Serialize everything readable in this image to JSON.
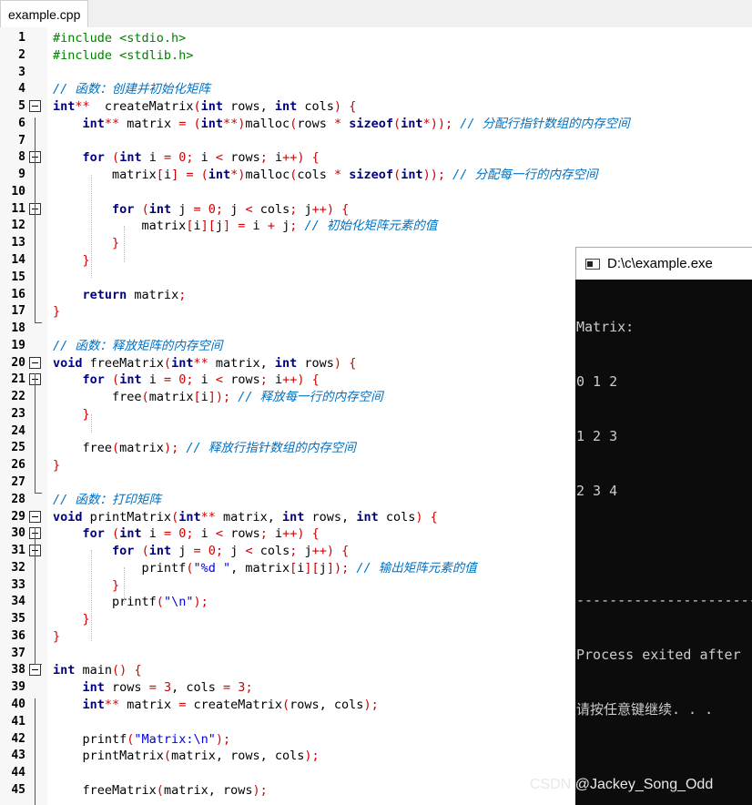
{
  "tab": {
    "label": "example.cpp"
  },
  "lines": [
    {
      "n": "1",
      "tokens": [
        [
          "pp",
          "#include <stdio.h>"
        ]
      ]
    },
    {
      "n": "2",
      "tokens": [
        [
          "pp",
          "#include <stdlib.h>"
        ]
      ]
    },
    {
      "n": "3",
      "tokens": []
    },
    {
      "n": "4",
      "tokens": [
        [
          "cm",
          "// 函数：创建并初始化矩阵"
        ]
      ]
    },
    {
      "n": "5",
      "fold": true,
      "tokens": [
        [
          "ty",
          "int"
        ],
        [
          "op",
          "**"
        ],
        [
          "",
          "  createMatrix"
        ],
        [
          "op",
          "("
        ],
        [
          "ty",
          "int"
        ],
        [
          "",
          " rows, "
        ],
        [
          "ty",
          "int"
        ],
        [
          "",
          " cols"
        ],
        [
          "op",
          ")"
        ],
        [
          "",
          " "
        ],
        [
          "op",
          "{"
        ]
      ]
    },
    {
      "n": "6",
      "tokens": [
        [
          "",
          "    "
        ],
        [
          "ty",
          "int"
        ],
        [
          "op",
          "**"
        ],
        [
          "",
          " matrix "
        ],
        [
          "op",
          "="
        ],
        [
          "",
          " "
        ],
        [
          "op",
          "("
        ],
        [
          "ty",
          "int"
        ],
        [
          "op",
          "**)"
        ],
        [
          "",
          "malloc"
        ],
        [
          "op",
          "("
        ],
        [
          "",
          "rows "
        ],
        [
          "op",
          "*"
        ],
        [
          "",
          " "
        ],
        [
          "kw",
          "sizeof"
        ],
        [
          "op",
          "("
        ],
        [
          "ty",
          "int"
        ],
        [
          "op",
          "*));"
        ],
        [
          "",
          " "
        ],
        [
          "cm",
          "// 分配行指针数组的内存空间"
        ]
      ]
    },
    {
      "n": "7",
      "tokens": []
    },
    {
      "n": "8",
      "fold": true,
      "tokens": [
        [
          "",
          "    "
        ],
        [
          "kw",
          "for"
        ],
        [
          "",
          " "
        ],
        [
          "op",
          "("
        ],
        [
          "ty",
          "int"
        ],
        [
          "",
          " i "
        ],
        [
          "op",
          "="
        ],
        [
          "",
          " "
        ],
        [
          "num",
          "0"
        ],
        [
          "op",
          ";"
        ],
        [
          "",
          " i "
        ],
        [
          "op",
          "<"
        ],
        [
          "",
          " rows"
        ],
        [
          "op",
          ";"
        ],
        [
          "",
          " i"
        ],
        [
          "op",
          "++)"
        ],
        [
          "",
          " "
        ],
        [
          "op",
          "{"
        ]
      ]
    },
    {
      "n": "9",
      "tokens": [
        [
          "",
          "        matrix"
        ],
        [
          "op",
          "["
        ],
        [
          "",
          "i"
        ],
        [
          "op",
          "]"
        ],
        [
          "",
          " "
        ],
        [
          "op",
          "="
        ],
        [
          "",
          " "
        ],
        [
          "op",
          "("
        ],
        [
          "ty",
          "int"
        ],
        [
          "op",
          "*)"
        ],
        [
          "",
          "malloc"
        ],
        [
          "op",
          "("
        ],
        [
          "",
          "cols "
        ],
        [
          "op",
          "*"
        ],
        [
          "",
          " "
        ],
        [
          "kw",
          "sizeof"
        ],
        [
          "op",
          "("
        ],
        [
          "ty",
          "int"
        ],
        [
          "op",
          "));"
        ],
        [
          "",
          " "
        ],
        [
          "cm",
          "// 分配每一行的内存空间"
        ]
      ]
    },
    {
      "n": "10",
      "tokens": []
    },
    {
      "n": "11",
      "fold": true,
      "tokens": [
        [
          "",
          "        "
        ],
        [
          "kw",
          "for"
        ],
        [
          "",
          " "
        ],
        [
          "op",
          "("
        ],
        [
          "ty",
          "int"
        ],
        [
          "",
          " j "
        ],
        [
          "op",
          "="
        ],
        [
          "",
          " "
        ],
        [
          "num",
          "0"
        ],
        [
          "op",
          ";"
        ],
        [
          "",
          " j "
        ],
        [
          "op",
          "<"
        ],
        [
          "",
          " cols"
        ],
        [
          "op",
          ";"
        ],
        [
          "",
          " j"
        ],
        [
          "op",
          "++)"
        ],
        [
          "",
          " "
        ],
        [
          "op",
          "{"
        ]
      ]
    },
    {
      "n": "12",
      "tokens": [
        [
          "",
          "            matrix"
        ],
        [
          "op",
          "["
        ],
        [
          "",
          "i"
        ],
        [
          "op",
          "]["
        ],
        [
          "",
          "j"
        ],
        [
          "op",
          "]"
        ],
        [
          "",
          " "
        ],
        [
          "op",
          "="
        ],
        [
          "",
          " i "
        ],
        [
          "op",
          "+"
        ],
        [
          "",
          " j"
        ],
        [
          "op",
          ";"
        ],
        [
          "",
          " "
        ],
        [
          "cm",
          "// 初始化矩阵元素的值"
        ]
      ]
    },
    {
      "n": "13",
      "tokens": [
        [
          "",
          "        "
        ],
        [
          "op",
          "}"
        ]
      ]
    },
    {
      "n": "14",
      "tokens": [
        [
          "",
          "    "
        ],
        [
          "op",
          "}"
        ]
      ]
    },
    {
      "n": "15",
      "tokens": []
    },
    {
      "n": "16",
      "tokens": [
        [
          "",
          "    "
        ],
        [
          "kw",
          "return"
        ],
        [
          "",
          " matrix"
        ],
        [
          "op",
          ";"
        ]
      ]
    },
    {
      "n": "17",
      "tokens": [
        [
          "op",
          "}"
        ]
      ]
    },
    {
      "n": "18",
      "tokens": []
    },
    {
      "n": "19",
      "tokens": [
        [
          "cm",
          "// 函数：释放矩阵的内存空间"
        ]
      ]
    },
    {
      "n": "20",
      "fold": true,
      "tokens": [
        [
          "kw",
          "void"
        ],
        [
          "",
          " freeMatrix"
        ],
        [
          "op",
          "("
        ],
        [
          "ty",
          "int"
        ],
        [
          "op",
          "**"
        ],
        [
          "",
          " matrix, "
        ],
        [
          "ty",
          "int"
        ],
        [
          "",
          " rows"
        ],
        [
          "op",
          ")"
        ],
        [
          "",
          " "
        ],
        [
          "op",
          "{"
        ]
      ]
    },
    {
      "n": "21",
      "fold": true,
      "tokens": [
        [
          "",
          "    "
        ],
        [
          "kw",
          "for"
        ],
        [
          "",
          " "
        ],
        [
          "op",
          "("
        ],
        [
          "ty",
          "int"
        ],
        [
          "",
          " i "
        ],
        [
          "op",
          "="
        ],
        [
          "",
          " "
        ],
        [
          "num",
          "0"
        ],
        [
          "op",
          ";"
        ],
        [
          "",
          " i "
        ],
        [
          "op",
          "<"
        ],
        [
          "",
          " rows"
        ],
        [
          "op",
          ";"
        ],
        [
          "",
          " i"
        ],
        [
          "op",
          "++)"
        ],
        [
          "",
          " "
        ],
        [
          "op",
          "{"
        ]
      ]
    },
    {
      "n": "22",
      "tokens": [
        [
          "",
          "        free"
        ],
        [
          "op",
          "("
        ],
        [
          "",
          "matrix"
        ],
        [
          "op",
          "["
        ],
        [
          "",
          "i"
        ],
        [
          "op",
          "]);"
        ],
        [
          "",
          " "
        ],
        [
          "cm",
          "// 释放每一行的内存空间"
        ]
      ]
    },
    {
      "n": "23",
      "tokens": [
        [
          "",
          "    "
        ],
        [
          "op",
          "}"
        ]
      ]
    },
    {
      "n": "24",
      "tokens": []
    },
    {
      "n": "25",
      "tokens": [
        [
          "",
          "    free"
        ],
        [
          "op",
          "("
        ],
        [
          "",
          "matrix"
        ],
        [
          "op",
          ");"
        ],
        [
          "",
          " "
        ],
        [
          "cm",
          "// 释放行指针数组的内存空间"
        ]
      ]
    },
    {
      "n": "26",
      "tokens": [
        [
          "op",
          "}"
        ]
      ]
    },
    {
      "n": "27",
      "tokens": []
    },
    {
      "n": "28",
      "tokens": [
        [
          "cm",
          "// 函数：打印矩阵"
        ]
      ]
    },
    {
      "n": "29",
      "fold": true,
      "tokens": [
        [
          "kw",
          "void"
        ],
        [
          "",
          " printMatrix"
        ],
        [
          "op",
          "("
        ],
        [
          "ty",
          "int"
        ],
        [
          "op",
          "**"
        ],
        [
          "",
          " matrix, "
        ],
        [
          "ty",
          "int"
        ],
        [
          "",
          " rows, "
        ],
        [
          "ty",
          "int"
        ],
        [
          "",
          " cols"
        ],
        [
          "op",
          ")"
        ],
        [
          "",
          " "
        ],
        [
          "op",
          "{"
        ]
      ]
    },
    {
      "n": "30",
      "fold": true,
      "tokens": [
        [
          "",
          "    "
        ],
        [
          "kw",
          "for"
        ],
        [
          "",
          " "
        ],
        [
          "op",
          "("
        ],
        [
          "ty",
          "int"
        ],
        [
          "",
          " i "
        ],
        [
          "op",
          "="
        ],
        [
          "",
          " "
        ],
        [
          "num",
          "0"
        ],
        [
          "op",
          ";"
        ],
        [
          "",
          " i "
        ],
        [
          "op",
          "<"
        ],
        [
          "",
          " rows"
        ],
        [
          "op",
          ";"
        ],
        [
          "",
          " i"
        ],
        [
          "op",
          "++)"
        ],
        [
          "",
          " "
        ],
        [
          "op",
          "{"
        ]
      ]
    },
    {
      "n": "31",
      "fold": true,
      "tokens": [
        [
          "",
          "        "
        ],
        [
          "kw",
          "for"
        ],
        [
          "",
          " "
        ],
        [
          "op",
          "("
        ],
        [
          "ty",
          "int"
        ],
        [
          "",
          " j "
        ],
        [
          "op",
          "="
        ],
        [
          "",
          " "
        ],
        [
          "num",
          "0"
        ],
        [
          "op",
          ";"
        ],
        [
          "",
          " j "
        ],
        [
          "op",
          "<"
        ],
        [
          "",
          " cols"
        ],
        [
          "op",
          ";"
        ],
        [
          "",
          " j"
        ],
        [
          "op",
          "++)"
        ],
        [
          "",
          " "
        ],
        [
          "op",
          "{"
        ]
      ]
    },
    {
      "n": "32",
      "tokens": [
        [
          "",
          "            printf"
        ],
        [
          "op",
          "("
        ],
        [
          "str",
          "\"%d \""
        ],
        [
          "",
          ", matrix"
        ],
        [
          "op",
          "["
        ],
        [
          "",
          "i"
        ],
        [
          "op",
          "]["
        ],
        [
          "",
          "j"
        ],
        [
          "op",
          "]);"
        ],
        [
          "",
          " "
        ],
        [
          "cm",
          "// 输出矩阵元素的值"
        ]
      ]
    },
    {
      "n": "33",
      "tokens": [
        [
          "",
          "        "
        ],
        [
          "op",
          "}"
        ]
      ]
    },
    {
      "n": "34",
      "tokens": [
        [
          "",
          "        printf"
        ],
        [
          "op",
          "("
        ],
        [
          "str",
          "\"\\n\""
        ],
        [
          "op",
          ");"
        ]
      ]
    },
    {
      "n": "35",
      "tokens": [
        [
          "",
          "    "
        ],
        [
          "op",
          "}"
        ]
      ]
    },
    {
      "n": "36",
      "tokens": [
        [
          "op",
          "}"
        ]
      ]
    },
    {
      "n": "37",
      "tokens": []
    },
    {
      "n": "38",
      "fold": true,
      "tokens": [
        [
          "ty",
          "int"
        ],
        [
          "",
          " main"
        ],
        [
          "op",
          "()"
        ],
        [
          "",
          " "
        ],
        [
          "op",
          "{"
        ]
      ]
    },
    {
      "n": "39",
      "tokens": [
        [
          "",
          "    "
        ],
        [
          "ty",
          "int"
        ],
        [
          "",
          " rows "
        ],
        [
          "op",
          "="
        ],
        [
          "",
          " "
        ],
        [
          "num",
          "3"
        ],
        [
          "",
          ", cols "
        ],
        [
          "op",
          "="
        ],
        [
          "",
          " "
        ],
        [
          "num",
          "3"
        ],
        [
          "op",
          ";"
        ]
      ]
    },
    {
      "n": "40",
      "tokens": [
        [
          "",
          "    "
        ],
        [
          "ty",
          "int"
        ],
        [
          "op",
          "**"
        ],
        [
          "",
          " matrix "
        ],
        [
          "op",
          "="
        ],
        [
          "",
          " createMatrix"
        ],
        [
          "op",
          "("
        ],
        [
          "",
          "rows, cols"
        ],
        [
          "op",
          ");"
        ]
      ]
    },
    {
      "n": "41",
      "tokens": []
    },
    {
      "n": "42",
      "tokens": [
        [
          "",
          "    printf"
        ],
        [
          "op",
          "("
        ],
        [
          "str",
          "\"Matrix:\\n\""
        ],
        [
          "op",
          ");"
        ]
      ]
    },
    {
      "n": "43",
      "tokens": [
        [
          "",
          "    printMatrix"
        ],
        [
          "op",
          "("
        ],
        [
          "",
          "matrix, rows, cols"
        ],
        [
          "op",
          ");"
        ]
      ]
    },
    {
      "n": "44",
      "tokens": []
    },
    {
      "n": "45",
      "tokens": [
        [
          "",
          "    freeMatrix"
        ],
        [
          "op",
          "("
        ],
        [
          "",
          "matrix, rows"
        ],
        [
          "op",
          ");"
        ]
      ]
    }
  ],
  "console": {
    "title": "D:\\c\\example.exe",
    "lines": [
      "Matrix:",
      "0 1 2",
      "1 2 3",
      "2 3 4",
      "",
      "--------------------------------",
      "Process exited after",
      "请按任意键继续. . ."
    ]
  },
  "watermark": "CSDN @Jackey_Song_Odd"
}
